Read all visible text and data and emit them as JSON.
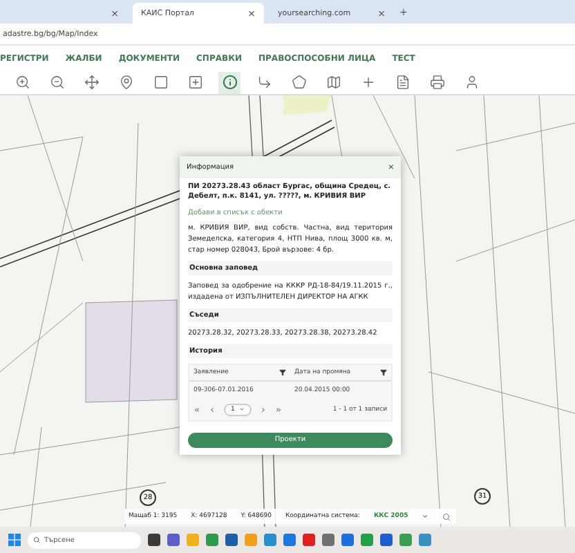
{
  "browser": {
    "tabs": [
      {
        "selected": false
      },
      {
        "title": "КАИС Портал",
        "selected": true
      },
      {
        "title": "yoursearching.com",
        "selected": false
      }
    ],
    "new_tab": "+",
    "close": "×",
    "address": "adastre.bg/bg/Map/Index"
  },
  "nav": [
    "РЕГИСТРИ",
    "ЖАЛБИ",
    "ДОКУМЕНТИ",
    "СПРАВКИ",
    "ПРАВОСПОСОБНИ ЛИЦА",
    "ТЕСТ"
  ],
  "toolbar": [
    {
      "kind": "zoom-in",
      "selected": false
    },
    {
      "kind": "zoom-out",
      "selected": false
    },
    {
      "kind": "pan",
      "selected": false
    },
    {
      "kind": "pin",
      "selected": false
    },
    {
      "kind": "select",
      "selected": false
    },
    {
      "kind": "select-plus",
      "selected": false
    },
    {
      "kind": "info",
      "selected": true
    },
    {
      "kind": "corner",
      "selected": false
    },
    {
      "kind": "polygon",
      "selected": false
    },
    {
      "kind": "map",
      "selected": false
    },
    {
      "kind": "cross",
      "selected": false
    },
    {
      "kind": "doc",
      "selected": false
    },
    {
      "kind": "print",
      "selected": false
    },
    {
      "kind": "user",
      "selected": false
    }
  ],
  "map_labels": [
    "28",
    "31"
  ],
  "dialog": {
    "title": "Информация",
    "close": "×",
    "heading": "ПИ 20273.28.43 област Бургас, община Средец, с. Дебелт, п.к. 8141, ул. ?????, м. КРИВИЯ ВИР",
    "link": "Добави в списък с обекти",
    "description": "м. КРИВИЯ ВИР, вид собств. Частна, вид територия Земеделска, категория 4, НТП Нива, площ 3000 кв. м, стар номер 028043, Брой вързове: 4 бр.",
    "sections": [
      {
        "title": "Основна заповед",
        "text": "Заповед за одобрение на КККР РД-18-84/19.11.2015 г., издадена от ИЗПЪЛНИТЕЛЕН ДИРЕКТОР НА АГКК"
      },
      {
        "title": "Съседи",
        "text": "20273.28.32, 20273.28.33, 20273.28.38, 20273.28.42"
      }
    ],
    "history": {
      "title": "История",
      "columns": [
        "Заявление",
        "Дата на промяна"
      ],
      "rows": [
        [
          "09-306-07.01.2016",
          "20.04.2015 00:00"
        ]
      ],
      "page": "1",
      "summary": "1 - 1 от 1 записи"
    },
    "button": "Проекти"
  },
  "status": {
    "scale": "Мащаб 1: 3195",
    "x": "X: 4697128",
    "y": "Y: 648690",
    "crs_label": "Координатна система:",
    "crs": "ККС 2005"
  },
  "taskbar": {
    "search": "Търсене",
    "apps": [
      {
        "color": "#3a3a3a"
      },
      {
        "color": "#5b5fc7"
      },
      {
        "color": "#f2b01e"
      },
      {
        "color": "#2e9b4e"
      },
      {
        "color": "#1e5fa8"
      },
      {
        "color": "#f0a020"
      },
      {
        "color": "#2a8fd0"
      },
      {
        "color": "#1e77e0"
      },
      {
        "color": "#e02020"
      },
      {
        "color": "#707070"
      },
      {
        "color": "#1e6fd9"
      },
      {
        "color": "#25a04a"
      },
      {
        "color": "#1e5fd0"
      },
      {
        "color": "#3aa050"
      },
      {
        "color": "#3a90c0"
      }
    ]
  }
}
